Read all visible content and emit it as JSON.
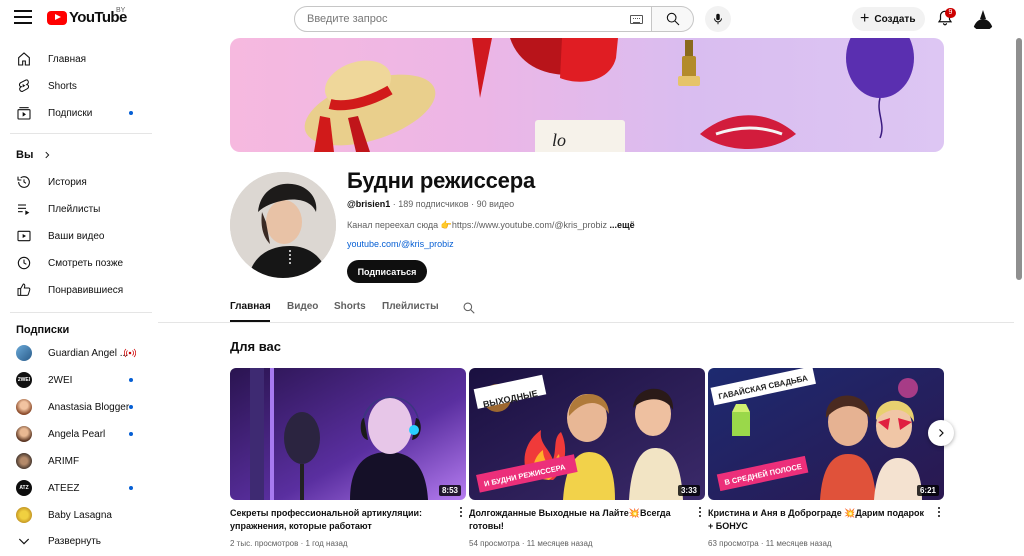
{
  "header": {
    "logo_text": "YouTube",
    "region": "BY",
    "search_placeholder": "Введите запрос",
    "create_label": "Создать",
    "notifications_count": "9"
  },
  "sidebar": {
    "main_items": [
      {
        "label": "Главная",
        "icon": "home-icon"
      },
      {
        "label": "Shorts",
        "icon": "shorts-icon"
      },
      {
        "label": "Подписки",
        "icon": "subscriptions-icon",
        "new_content": true
      }
    ],
    "you_heading": "Вы",
    "you_items": [
      {
        "label": "История",
        "icon": "history-icon"
      },
      {
        "label": "Плейлисты",
        "icon": "playlists-icon"
      },
      {
        "label": "Ваши видео",
        "icon": "your-videos-icon"
      },
      {
        "label": "Смотреть позже",
        "icon": "watch-later-icon"
      },
      {
        "label": "Понравившиеся",
        "icon": "liked-icon"
      }
    ],
    "subscriptions_heading": "Подписки",
    "subscriptions": [
      {
        "label": "Guardian Angel ...",
        "status": "live"
      },
      {
        "label": "2WEI",
        "status": "new"
      },
      {
        "label": "Anastasia Blogger",
        "status": "new"
      },
      {
        "label": "Angela Pearl",
        "status": "new"
      },
      {
        "label": "ARIMF",
        "status": ""
      },
      {
        "label": "ATEEZ",
        "status": "new"
      },
      {
        "label": "Baby Lasagna",
        "status": ""
      }
    ],
    "expand_label": "Развернуть"
  },
  "channel": {
    "name": "Будни режиссера",
    "handle": "@brisien1",
    "meta": " · 189 подписчиков · 90 видео",
    "description": "Канал переехал сюда 👉https://www.youtube.com/@kris_probiz ",
    "description_more": "...ещё",
    "link": "youtube.com/@kris_probiz",
    "subscribe_label": "Подписаться"
  },
  "tabs": [
    {
      "label": "Главная",
      "active": true
    },
    {
      "label": "Видео",
      "active": false
    },
    {
      "label": "Shorts",
      "active": false
    },
    {
      "label": "Плейлисты",
      "active": false
    }
  ],
  "section_title": "Для вас",
  "videos": [
    {
      "title": "Секреты профессиональной артикуляции: упражнения, которые работают",
      "duration": "8:53",
      "meta": "2 тыс. просмотров · 1 год назад"
    },
    {
      "title": "Долгожданные Выходные на Лайте💥Всегда готовы!",
      "duration": "3:33",
      "meta": "54 просмотра · 11 месяцев назад",
      "thumb_text_top": "ВЫХОДНЫЕ",
      "thumb_text_bottom": "И БУДНИ РЕЖИССЕРА"
    },
    {
      "title": "Кристина и Аня в Доброграде 💥Дарим подарок + БОНУС",
      "duration": "6:21",
      "meta": "63 просмотра · 11 месяцев назад",
      "thumb_text_top": "ГАВАЙСКАЯ СВАДЬБА",
      "thumb_text_bottom": "В СРЕДНЕЙ ПОЛОСЕ"
    }
  ]
}
